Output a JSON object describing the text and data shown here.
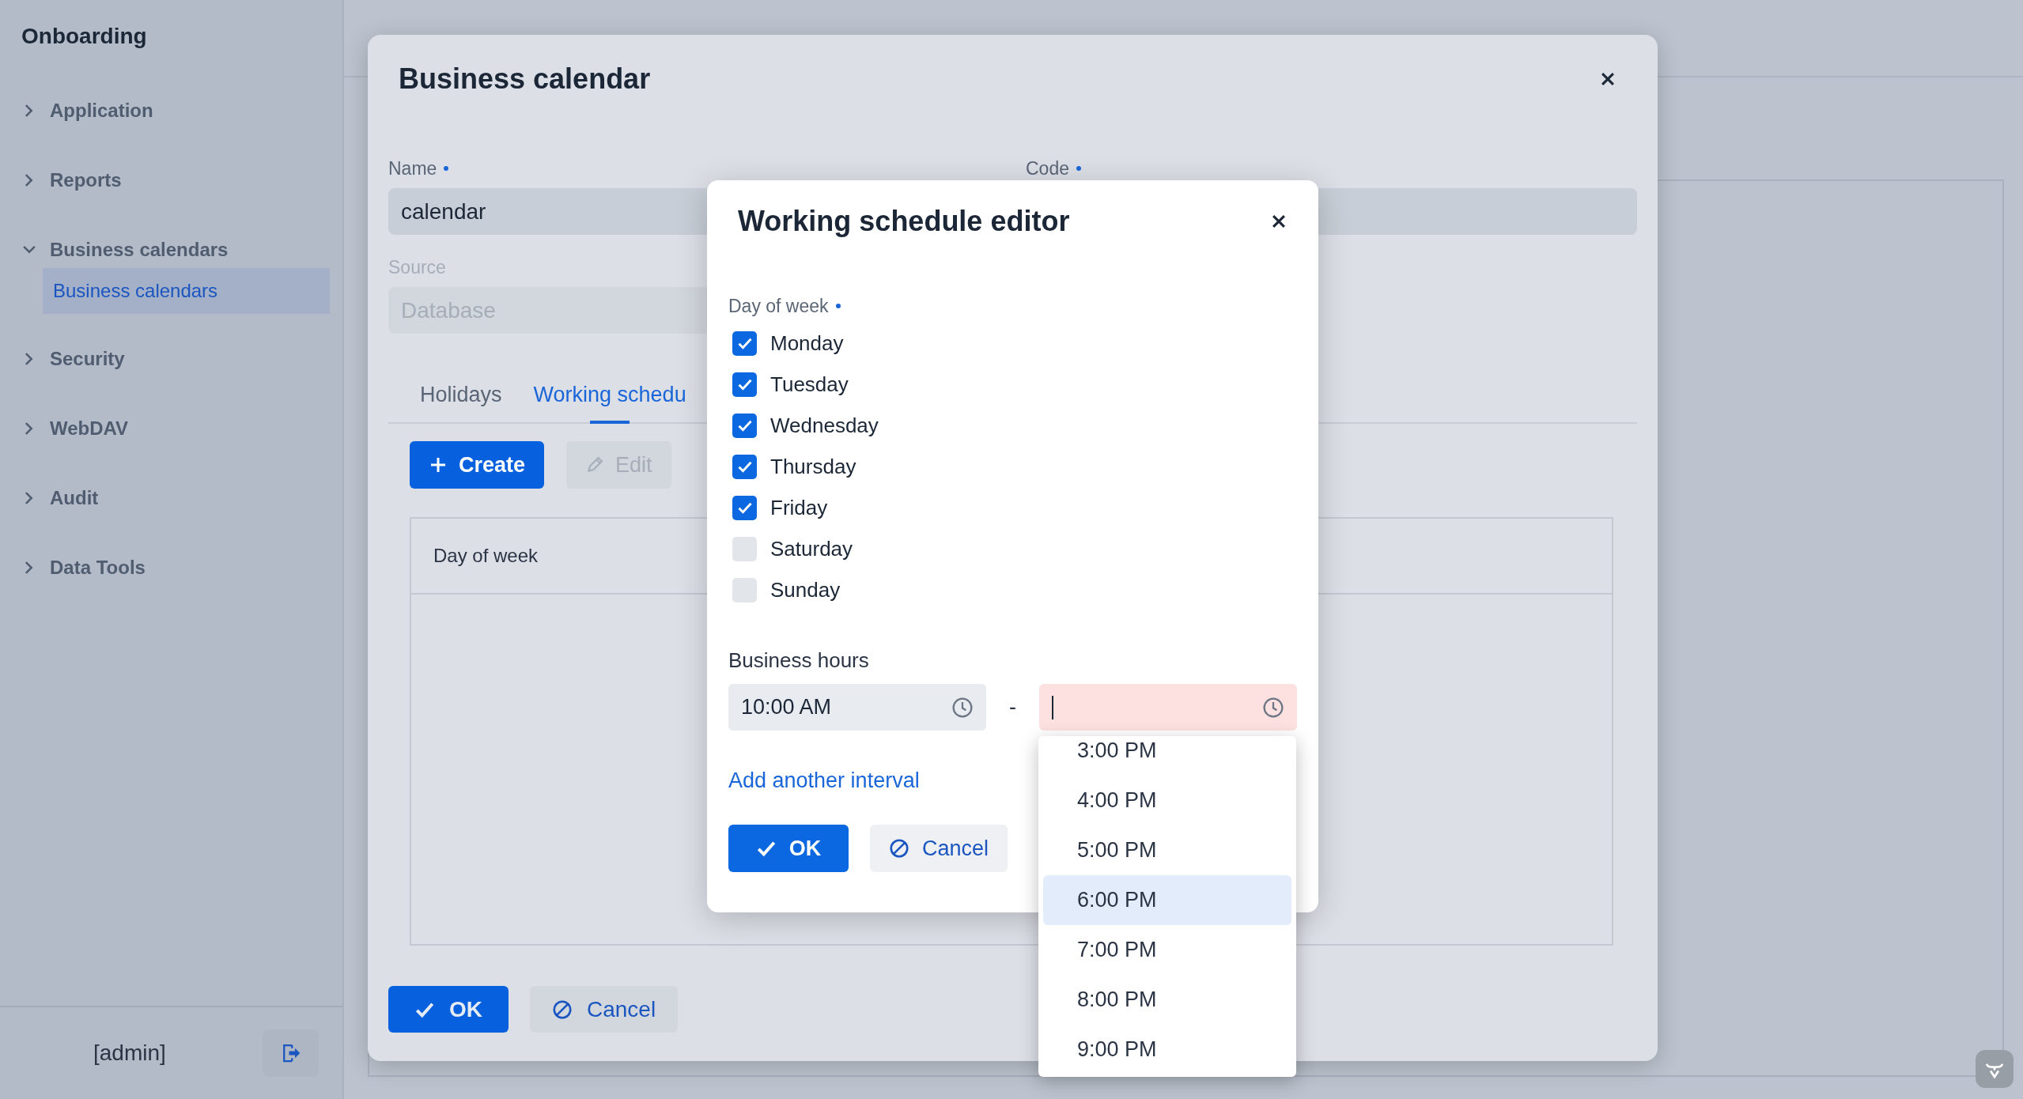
{
  "sidebar": {
    "title": "Onboarding",
    "items": [
      {
        "label": "Application",
        "expanded": false
      },
      {
        "label": "Reports",
        "expanded": false
      },
      {
        "label": "Business calendars",
        "expanded": true,
        "children": [
          {
            "label": "Business calendars",
            "selected": true
          }
        ]
      },
      {
        "label": "Security",
        "expanded": false
      },
      {
        "label": "WebDAV",
        "expanded": false
      },
      {
        "label": "Audit",
        "expanded": false
      },
      {
        "label": "Data Tools",
        "expanded": false
      }
    ],
    "user": "[admin]"
  },
  "dialog": {
    "title": "Business calendar",
    "fields": [
      {
        "label": "Name",
        "required": true,
        "value": "calendar",
        "disabled": false
      },
      {
        "label": "Code",
        "required": true,
        "disabled": false
      }
    ],
    "source": {
      "label": "Source",
      "value": "Database",
      "disabled": true
    },
    "tabs": [
      {
        "label": "Holidays",
        "selected": false
      },
      {
        "label": "Working schedu",
        "selected": true
      }
    ],
    "toolbar": [
      {
        "label": "Create",
        "kind": "create",
        "disabled": false
      },
      {
        "label": "Edit",
        "kind": "edit",
        "disabled": true
      }
    ],
    "table": {
      "columns": [
        "Day of week"
      ]
    },
    "buttons": [
      {
        "label": "OK",
        "kind": "ok"
      },
      {
        "label": "Cancel",
        "kind": "cancel"
      }
    ]
  },
  "editor": {
    "title": "Working schedule editor",
    "days_label": "Day of week",
    "days_required": true,
    "days": [
      {
        "label": "Monday",
        "checked": true
      },
      {
        "label": "Tuesday",
        "checked": true
      },
      {
        "label": "Wednesday",
        "checked": true
      },
      {
        "label": "Thursday",
        "checked": true
      },
      {
        "label": "Friday",
        "checked": true
      },
      {
        "label": "Saturday",
        "checked": false
      },
      {
        "label": "Sunday",
        "checked": false
      }
    ],
    "hours_label": "Business hours",
    "start": {
      "value": "10:00 AM",
      "invalid": false
    },
    "separator": "-",
    "end": {
      "invalid": true
    },
    "add_link": "Add another interval",
    "buttons": [
      {
        "label": "OK",
        "kind": "ok"
      },
      {
        "label": "Cancel",
        "kind": "cancel"
      }
    ]
  },
  "time_dropdown": {
    "options": [
      {
        "label": "3:00 PM",
        "selected": false
      },
      {
        "label": "4:00 PM",
        "selected": false
      },
      {
        "label": "5:00 PM",
        "selected": false
      },
      {
        "label": "6:00 PM",
        "selected": true
      },
      {
        "label": "7:00 PM",
        "selected": false
      },
      {
        "label": "8:00 PM",
        "selected": false
      },
      {
        "label": "9:00 PM",
        "selected": false
      }
    ]
  }
}
